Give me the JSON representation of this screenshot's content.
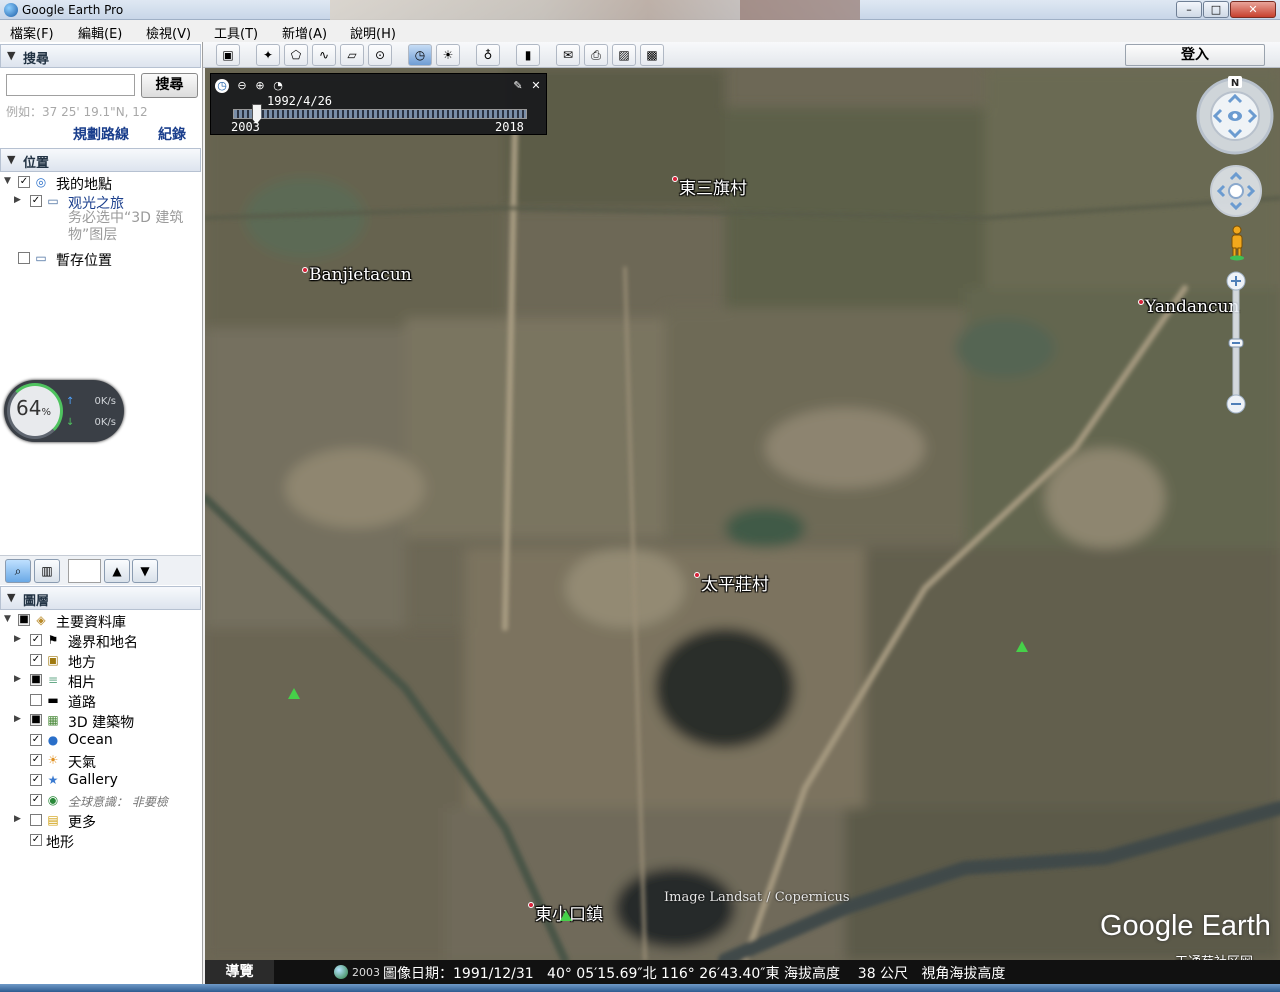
{
  "window": {
    "title": "Google Earth Pro",
    "min": "–",
    "max": "□",
    "close": "✕"
  },
  "menu": [
    "檔案(F)",
    "編輯(E)",
    "檢視(V)",
    "工具(T)",
    "新增(A)",
    "說明(H)"
  ],
  "search": {
    "header": "搜尋",
    "input_value": "",
    "button": "搜尋",
    "example": "例如：37 25' 19.1\"N, 12",
    "route_link": "規劃路線",
    "history_link": "紀錄"
  },
  "places": {
    "header": "位置",
    "items": [
      {
        "label": "我的地點",
        "checked": true,
        "icon": "globe-icon"
      },
      {
        "label": "观光之旅",
        "checked": true,
        "icon": "folder-icon"
      },
      {
        "label": "暫存位置",
        "checked": false,
        "icon": "folder-icon"
      }
    ],
    "note": "务必选中“3D 建筑物”图层"
  },
  "speed_widget": {
    "percent": "64",
    "unit": "%",
    "up": "0K/s",
    "down": "0K/s"
  },
  "layers": {
    "header": "圖層",
    "items": [
      {
        "label": "主要資料庫",
        "icon": "database-icon"
      },
      {
        "label": "邊界和地名",
        "icon": "flag-icon"
      },
      {
        "label": "地方",
        "icon": "place-icon"
      },
      {
        "label": "相片",
        "icon": "photo-icon"
      },
      {
        "label": "道路",
        "icon": "road-icon"
      },
      {
        "label": "3D 建築物",
        "icon": "building-icon"
      },
      {
        "label": "Ocean",
        "icon": "ocean-icon"
      },
      {
        "label": "天氣",
        "icon": "weather-icon"
      },
      {
        "label": "Gallery",
        "icon": "gallery-icon"
      },
      {
        "label": "全球意識： 非要檢",
        "icon": "earth-icon"
      },
      {
        "label": "更多",
        "icon": "more-icon"
      },
      {
        "label": "地形",
        "icon": "terrain-icon"
      }
    ]
  },
  "toolbar": {
    "login": "登入"
  },
  "time_slider": {
    "date": "1992/4/26",
    "start": "2003",
    "end": "2018",
    "position_fraction": 0.08
  },
  "map": {
    "places": [
      "東三旗村",
      "Banjietacun",
      "Yandancun",
      "太平莊村",
      "東小口鎮"
    ],
    "credit": "Image Landsat / Copernicus",
    "logo": "Google Earth",
    "watermark": "天通苑社区网",
    "north_label": "N"
  },
  "status": {
    "nav_tab": "導覽",
    "year": "2003",
    "text": "圖像日期：1991/12/31   40° 05′15.69″北 116° 26′43.40″東 海拔高度    38 公尺   視角海拔高度"
  }
}
